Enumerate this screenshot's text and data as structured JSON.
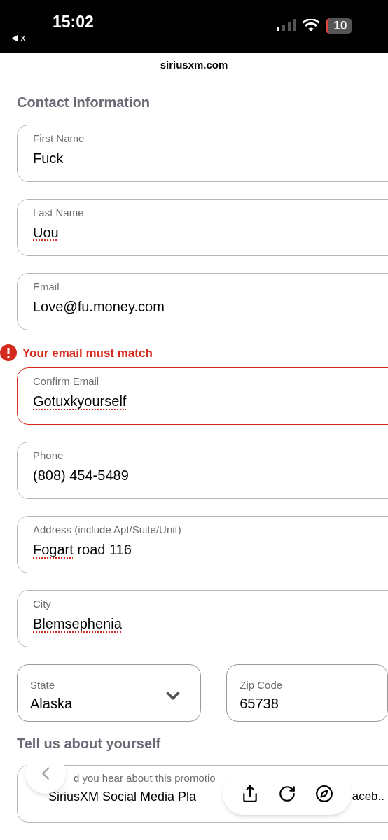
{
  "status_bar": {
    "time": "15:02",
    "back_app": "◀ x",
    "battery": "10"
  },
  "address_bar": {
    "url": "siriusxm.com"
  },
  "sections": [
    {
      "title": "Contact Information"
    }
  ],
  "fields": [
    {
      "label": "First Name",
      "value": [
        {
          "text": "Fuck",
          "misspelled": false
        }
      ],
      "error": false
    },
    {
      "label": "Last Name",
      "value": [
        {
          "text": "Uou",
          "misspelled": true
        }
      ],
      "error": false
    },
    {
      "label": "Email",
      "value": [
        {
          "text": "Love@fu.money.com",
          "misspelled": false
        }
      ],
      "error": false
    },
    {
      "label": "Confirm Email",
      "value": [
        {
          "text": "Gotuxkyourself",
          "misspelled": true
        }
      ],
      "error": true,
      "error_message": "Your email must match"
    },
    {
      "label": "Phone",
      "value": [
        {
          "text": "(808) 454-5489",
          "misspelled": false
        }
      ],
      "error": false
    },
    {
      "label": "Address (include Apt/Suite/Unit)",
      "value": [
        {
          "text": "Fogart",
          "misspelled": true
        },
        {
          "text": " road 116",
          "misspelled": false
        }
      ],
      "error": false
    },
    {
      "label": "City",
      "value": [
        {
          "text": "Blemsephenia",
          "misspelled": true
        }
      ],
      "error": false
    }
  ],
  "row_fields": [
    {
      "kind": "select",
      "label": "State",
      "value": "Alaska"
    },
    {
      "kind": "text",
      "label": "Zip Code",
      "value": "65738"
    }
  ],
  "section2": {
    "title": "Tell us about yourself",
    "field": {
      "label": "d you hear about this promotio",
      "value": "SiriusXM Social Media Pla",
      "value_end": "aceb.."
    }
  }
}
